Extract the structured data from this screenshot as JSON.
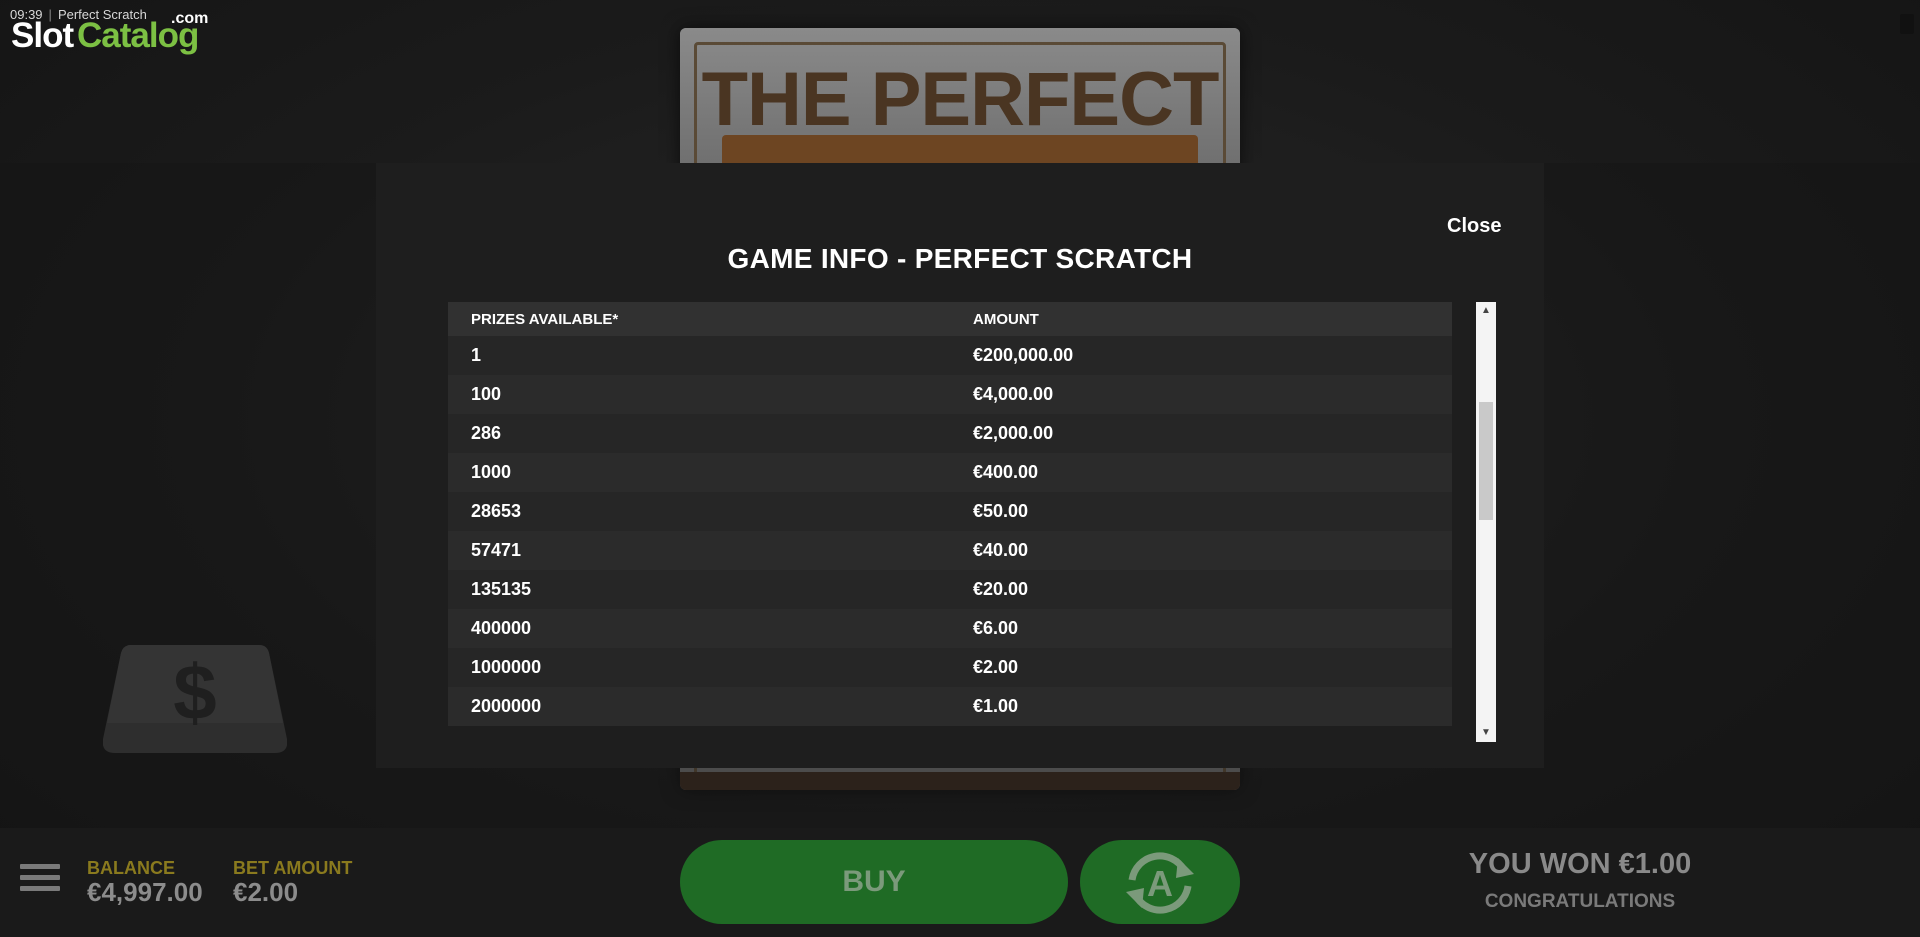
{
  "status": {
    "time": "09:39",
    "page_title": "Perfect Scratch"
  },
  "logo": {
    "part1": "Slot",
    "part2": "Catalog",
    "suffix": ".com"
  },
  "card": {
    "title": "THE PERFECT"
  },
  "modal": {
    "title": "GAME INFO - PERFECT SCRATCH",
    "close_label": "Close",
    "columns": [
      "PRIZES AVAILABLE*",
      "AMOUNT"
    ],
    "rows": [
      {
        "count": "1",
        "amount": "€200,000.00"
      },
      {
        "count": "100",
        "amount": "€4,000.00"
      },
      {
        "count": "286",
        "amount": "€2,000.00"
      },
      {
        "count": "1000",
        "amount": "€400.00"
      },
      {
        "count": "28653",
        "amount": "€50.00"
      },
      {
        "count": "57471",
        "amount": "€40.00"
      },
      {
        "count": "135135",
        "amount": "€20.00"
      },
      {
        "count": "400000",
        "amount": "€6.00"
      },
      {
        "count": "1000000",
        "amount": "€2.00"
      },
      {
        "count": "2000000",
        "amount": "€1.00"
      }
    ]
  },
  "bottom": {
    "balance_label": "BALANCE",
    "balance_value": "€4,997.00",
    "bet_label": "BET AMOUNT",
    "bet_value": "€2.00",
    "buy_label": "BUY",
    "won_text": "YOU WON €1.00",
    "congrats_text": "CONGRATULATIONS"
  },
  "icons": [
    "menu-icon",
    "autoplay-icon",
    "dollar-icon",
    "scroll-up-icon",
    "scroll-down-icon"
  ],
  "colors": {
    "accent_green": "#1f6b25",
    "label_gold": "#8a7a1e",
    "logo_green": "#7cc043"
  }
}
